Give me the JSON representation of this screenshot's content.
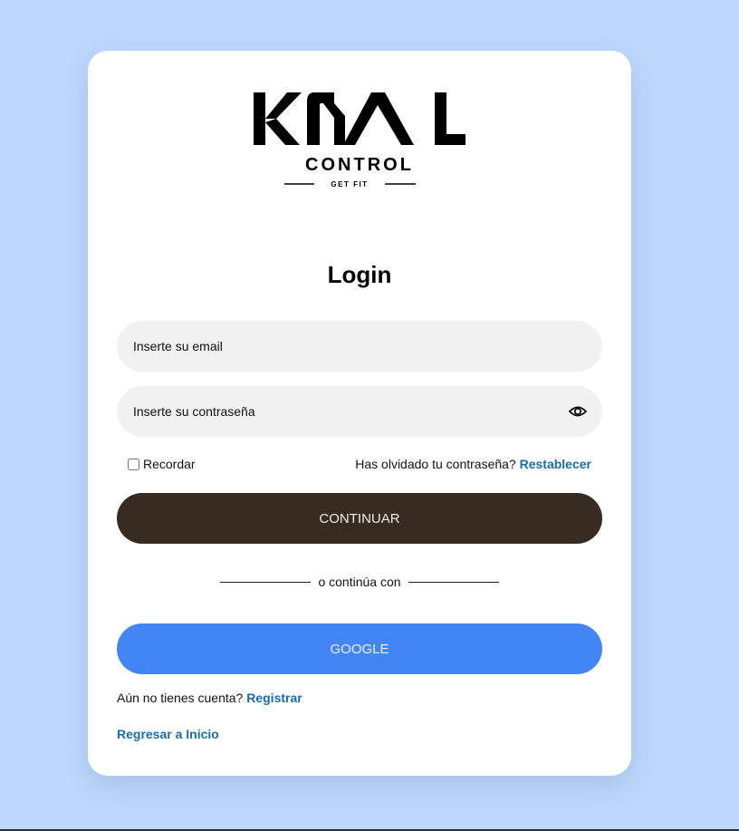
{
  "brand": {
    "logo_text": "KCAL",
    "subtitle": "CONTROL",
    "tagline": "GET FIT"
  },
  "login": {
    "title": "Login",
    "email_placeholder": "Inserte su email",
    "password_placeholder": "Inserte su contraseña",
    "remember_label": "Recordar",
    "forgot_text": "Has olvidado tu contraseña?",
    "reset_link": "Restablecer",
    "continue_button": "CONTINUAR",
    "divider_text": "o continúa con",
    "google_button": "GOOGLE",
    "register_prompt": "Aún no tienes cuenta?",
    "register_link": "Registrar",
    "back_link": "Regresar a Inicio"
  },
  "colors": {
    "page_background": "#bcd8fd",
    "continue_button": "#372b22",
    "google_button": "#4385f5",
    "link": "#1a6ea8"
  }
}
